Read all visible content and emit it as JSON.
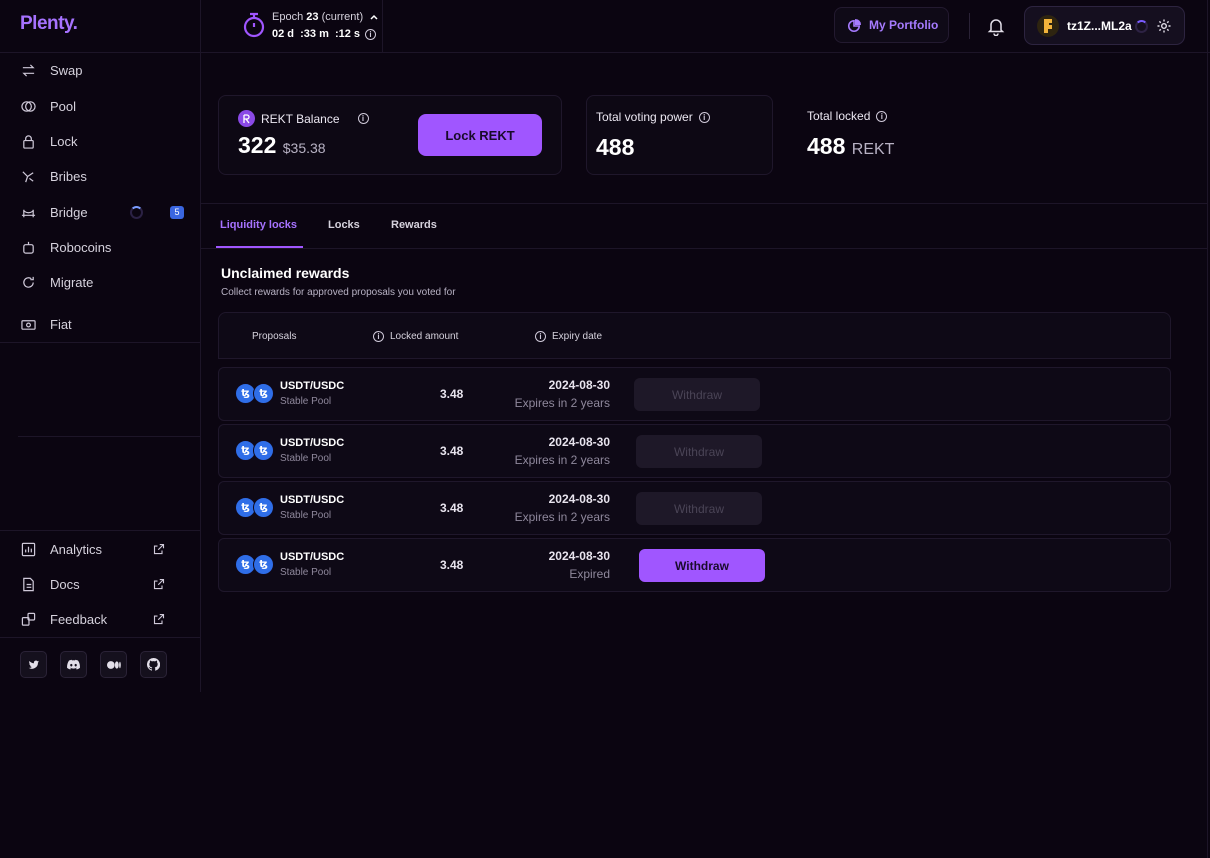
{
  "brand": {
    "logo": "Plenty."
  },
  "sidebar": {
    "items": [
      {
        "label": "Swap",
        "icon": "swap-icon"
      },
      {
        "label": "Pool",
        "icon": "pool-icon"
      },
      {
        "label": "Lock",
        "icon": "lock-icon"
      },
      {
        "label": "Bribes",
        "icon": "bribes-icon"
      },
      {
        "label": "Bridge",
        "icon": "bridge-icon",
        "badge": "5"
      },
      {
        "label": "Robocoins",
        "icon": "robocoins-icon"
      },
      {
        "label": "Migrate",
        "icon": "migrate-icon"
      },
      {
        "label": "Fiat",
        "icon": "fiat-icon"
      }
    ],
    "links": [
      {
        "label": "Analytics",
        "icon": "analytics-icon"
      },
      {
        "label": "Docs",
        "icon": "docs-icon"
      },
      {
        "label": "Feedback",
        "icon": "feedback-icon"
      }
    ],
    "socials": [
      "twitter-icon",
      "discord-icon",
      "medium-icon",
      "github-icon"
    ]
  },
  "header": {
    "epoch_prefix": "Epoch",
    "epoch_number": "23",
    "epoch_status": "(current)",
    "countdown": "02 d  :33 m  :12 s",
    "portfolio_label": "My Portfolio",
    "wallet_address": "tz1Z...ML2a"
  },
  "stats": {
    "balance_label": "REKT Balance",
    "balance_value": "322",
    "balance_usd": "$35.38",
    "lock_button": "Lock REKT",
    "voting_label": "Total voting power",
    "voting_value": "488",
    "locked_label": "Total locked",
    "locked_value": "488",
    "locked_unit": "REKT"
  },
  "tabs": [
    {
      "label": "Liquidity locks",
      "active": true
    },
    {
      "label": "Locks",
      "active": false
    },
    {
      "label": "Rewards",
      "active": false
    }
  ],
  "section": {
    "title": "Unclaimed rewards",
    "subtitle": "Collect rewards for approved proposals you voted for"
  },
  "table": {
    "headers": [
      "Proposals",
      "Locked amount",
      "Expiry date"
    ],
    "rows": [
      {
        "pair": "USDT/USDC",
        "pool": "Stable Pool",
        "amount": "3.48",
        "date": "2024-08-30",
        "expiry": "Expires in 2 years",
        "action": "Withdraw",
        "enabled": false
      },
      {
        "pair": "USDT/USDC",
        "pool": "Stable Pool",
        "amount": "3.48",
        "date": "2024-08-30",
        "expiry": "Expires in 2 years",
        "action": "Withdraw",
        "enabled": false
      },
      {
        "pair": "USDT/USDC",
        "pool": "Stable Pool",
        "amount": "3.48",
        "date": "2024-08-30",
        "expiry": "Expires in 2 years",
        "action": "Withdraw",
        "enabled": false
      },
      {
        "pair": "USDT/USDC",
        "pool": "Stable Pool",
        "amount": "3.48",
        "date": "2024-08-30",
        "expiry": "Expired",
        "action": "Withdraw",
        "enabled": true
      }
    ]
  },
  "colors": {
    "accent": "#a056ff",
    "background": "#0b0511",
    "token": "#2f6ee8"
  }
}
